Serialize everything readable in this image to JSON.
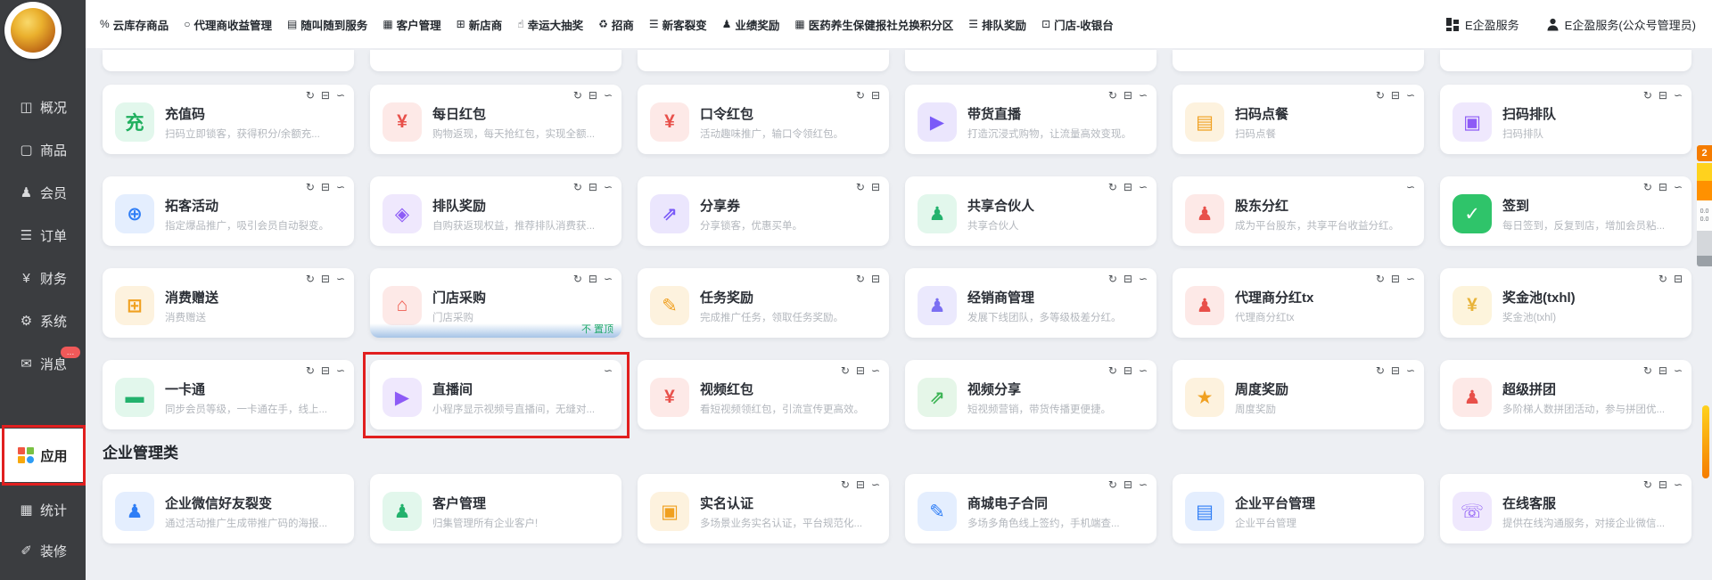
{
  "topnav": {
    "items": [
      {
        "label": "云库存商品",
        "icon": "%",
        "icon_name": "chain-link-icon"
      },
      {
        "label": "代理商收益管理",
        "icon": "○",
        "icon_name": "circle-icon"
      },
      {
        "label": "随叫随到服务",
        "icon": "▤",
        "icon_name": "service-card-icon"
      },
      {
        "label": "客户管理",
        "icon": "▦",
        "icon_name": "customer-grid-icon"
      },
      {
        "label": "新店商",
        "icon": "⊞",
        "icon_name": "new-shop-icon"
      },
      {
        "label": "幸运大抽奖",
        "icon": "☝",
        "icon_name": "lucky-draw-hand-icon"
      },
      {
        "label": "招商",
        "icon": "♻",
        "icon_name": "recycle-icon"
      },
      {
        "label": "新客裂变",
        "icon": "☰",
        "icon_name": "fission-list-icon"
      },
      {
        "label": "业绩奖励",
        "icon": "♟",
        "icon_name": "performance-award-icon"
      },
      {
        "label": "医药养生保健报社兑换积分区",
        "icon": "▦",
        "icon_name": "points-zone-icon"
      },
      {
        "label": "排队奖励",
        "icon": "☰",
        "icon_name": "queue-list-icon"
      },
      {
        "label": "门店-收银台",
        "icon": "⊡",
        "icon_name": "cashier-icon"
      }
    ],
    "service_label": "E企盈服务",
    "account_label": "E企盈服务(公众号管理员)"
  },
  "sidebar": {
    "items": [
      {
        "label": "概况",
        "icon": "◫",
        "icon_name": "overview-icon"
      },
      {
        "label": "商品",
        "icon": "▢",
        "icon_name": "goods-icon"
      },
      {
        "label": "会员",
        "icon": "♟",
        "icon_name": "members-icon"
      },
      {
        "label": "订单",
        "icon": "☰",
        "icon_name": "orders-cart-icon"
      },
      {
        "label": "财务",
        "icon": "¥",
        "icon_name": "finance-icon"
      },
      {
        "label": "系统",
        "icon": "⚙",
        "icon_name": "settings-gear-icon"
      },
      {
        "label": "消息",
        "icon": "✉",
        "icon_name": "messages-icon",
        "badge": "…"
      },
      {
        "label": "应用",
        "icon": "",
        "icon_name": "apps-icon",
        "active": true,
        "apps_icon": true,
        "red_box": true
      },
      {
        "label": "统计",
        "icon": "▦",
        "icon_name": "stats-icon"
      },
      {
        "label": "装修",
        "icon": "✐",
        "icon_name": "decorate-icon"
      }
    ]
  },
  "sections": [
    {
      "header": null,
      "rows": [
        [
          {
            "title": "充值码",
            "subtitle": "扫码立即锁客，获得积分/余额充...",
            "glyph": "充",
            "icon_name": "recharge-code-icon",
            "icon_color": "#1faf5e",
            "icon_bg": "#e2f7ec",
            "actions": [
              "sync",
              "print",
              "link"
            ]
          },
          {
            "title": "每日红包",
            "subtitle": "购物返现，每天抢红包，实现全额...",
            "glyph": "¥",
            "icon_name": "daily-redpacket-icon",
            "icon_color": "#e8504a",
            "icon_bg": "#fde9e7",
            "actions": [
              "sync",
              "print",
              "link"
            ]
          },
          {
            "title": "口令红包",
            "subtitle": "活动趣味推广，输口令领红包。",
            "glyph": "¥",
            "icon_name": "password-redpacket-icon",
            "icon_color": "#e8504a",
            "icon_bg": "#fde9e7",
            "actions": [
              "sync",
              "print"
            ]
          },
          {
            "title": "带货直播",
            "subtitle": "打造沉浸式购物，让流量高效变现。",
            "glyph": "▶",
            "icon_name": "live-commerce-icon",
            "icon_color": "#7a5af8",
            "icon_bg": "#ebe6fd",
            "actions": [
              "sync",
              "print",
              "link"
            ]
          },
          {
            "title": "扫码点餐",
            "subtitle": "扫码点餐",
            "glyph": "▤",
            "icon_name": "scan-order-icon",
            "icon_color": "#f0a020",
            "icon_bg": "#fdf2de",
            "actions": [
              "sync",
              "print",
              "link"
            ]
          },
          {
            "title": "扫码排队",
            "subtitle": "扫码排队",
            "glyph": "▣",
            "icon_name": "scan-queue-icon",
            "icon_color": "#8d5bf6",
            "icon_bg": "#efe8fd",
            "actions": [
              "sync",
              "print",
              "link"
            ]
          }
        ],
        [
          {
            "title": "拓客活动",
            "subtitle": "指定爆品推广，吸引会员自动裂变。",
            "glyph": "⊕",
            "icon_name": "customer-acquisition-icon",
            "icon_color": "#2f7ef6",
            "icon_bg": "#e4eefe",
            "actions": [
              "sync",
              "print",
              "link"
            ]
          },
          {
            "title": "排队奖励",
            "subtitle": "自购获返现权益，推荐排队消费获...",
            "glyph": "◈",
            "icon_name": "queue-reward-icon",
            "icon_color": "#8d5bf6",
            "icon_bg": "#efe8fd",
            "actions": [
              "sync",
              "print",
              "link"
            ]
          },
          {
            "title": "分享券",
            "subtitle": "分享锁客，优惠买单。",
            "glyph": "⇗",
            "icon_name": "share-coupon-icon",
            "icon_color": "#7a5af8",
            "icon_bg": "#ebe6fd",
            "actions": [
              "sync",
              "print"
            ]
          },
          {
            "title": "共享合伙人",
            "subtitle": "共享合伙人",
            "glyph": "♟",
            "icon_name": "shared-partner-icon",
            "icon_color": "#23b26d",
            "icon_bg": "#e2f7ec",
            "actions": [
              "sync",
              "print",
              "link"
            ]
          },
          {
            "title": "股东分红",
            "subtitle": "成为平台股东，共享平台收益分红。",
            "glyph": "♟",
            "icon_name": "shareholder-dividend-icon",
            "icon_color": "#e8504a",
            "icon_bg": "#fde9e7",
            "actions": [
              "link"
            ]
          },
          {
            "title": "签到",
            "subtitle": "每日签到，反复到店，增加会员粘...",
            "glyph": "✓",
            "icon_name": "checkin-calendar-icon",
            "icon_color": "#ffffff",
            "icon_bg": "#2fc46a",
            "actions": [
              "sync",
              "print",
              "link"
            ]
          }
        ],
        [
          {
            "title": "消费赠送",
            "subtitle": "消费赠送",
            "glyph": "⊞",
            "icon_name": "consume-gift-icon",
            "icon_color": "#f0a020",
            "icon_bg": "#fdf2de",
            "actions": [
              "sync",
              "print",
              "link"
            ]
          },
          {
            "title": "门店采购",
            "subtitle": "门店采购",
            "glyph": "⌂",
            "icon_name": "store-purchase-icon",
            "icon_color": "#ef5e52",
            "icon_bg": "#fde9e7",
            "actions": [
              "sync",
              "print",
              "link"
            ],
            "hl": true,
            "tag": "不 置顶"
          },
          {
            "title": "任务奖励",
            "subtitle": "完成推广任务，领取任务奖励。",
            "glyph": "✎",
            "icon_name": "task-reward-icon",
            "icon_color": "#f0a020",
            "icon_bg": "#fdf2de",
            "actions": [
              "sync",
              "print"
            ]
          },
          {
            "title": "经销商管理",
            "subtitle": "发展下线团队，多等级极差分红。",
            "glyph": "♟",
            "icon_name": "dealer-management-icon",
            "icon_color": "#7b6ff2",
            "icon_bg": "#ebe9fd",
            "actions": [
              "sync",
              "print",
              "link"
            ]
          },
          {
            "title": "代理商分红tx",
            "subtitle": "代理商分红tx",
            "glyph": "♟",
            "icon_name": "agent-dividend-icon",
            "icon_color": "#e8504a",
            "icon_bg": "#fde9e7",
            "actions": [
              "sync",
              "print",
              "link"
            ]
          },
          {
            "title": "奖金池(txhl)",
            "subtitle": "奖金池(txhl)",
            "glyph": "¥",
            "icon_name": "bonus-pool-icon",
            "icon_color": "#e8b339",
            "icon_bg": "#fdf4dc",
            "actions": [
              "sync",
              "print"
            ]
          }
        ],
        [
          {
            "title": "一卡通",
            "subtitle": "同步会员等级，一卡通在手，线上...",
            "glyph": "▬",
            "icon_name": "one-card-icon",
            "icon_color": "#23b26d",
            "icon_bg": "#e2f7ec",
            "actions": [
              "sync",
              "print",
              "link"
            ]
          },
          {
            "title": "直播间",
            "subtitle": "小程序显示视频号直播间，无缝对...",
            "glyph": "▶",
            "icon_name": "live-room-icon",
            "icon_color": "#8d5bf6",
            "icon_bg": "#efe8fd",
            "actions": [
              "link"
            ],
            "redbox": true
          },
          {
            "title": "视频红包",
            "subtitle": "看短视频领红包，引流宣传更高效。",
            "glyph": "¥",
            "icon_name": "video-redpacket-icon",
            "icon_color": "#e8504a",
            "icon_bg": "#fde9e7",
            "actions": [
              "sync",
              "print",
              "link"
            ]
          },
          {
            "title": "视频分享",
            "subtitle": "短视频营销，带货传播更便捷。",
            "glyph": "⇗",
            "icon_name": "video-share-icon",
            "icon_color": "#3cb454",
            "icon_bg": "#e5f6e8",
            "actions": [
              "sync",
              "print",
              "link"
            ]
          },
          {
            "title": "周度奖励",
            "subtitle": "周度奖励",
            "glyph": "★",
            "icon_name": "weekly-reward-icon",
            "icon_color": "#f0a020",
            "icon_bg": "#fdf2de",
            "actions": [
              "sync",
              "print",
              "link"
            ]
          },
          {
            "title": "超级拼团",
            "subtitle": "多阶梯人数拼团活动，参与拼团优...",
            "glyph": "♟",
            "icon_name": "super-groupbuy-icon",
            "icon_color": "#e8504a",
            "icon_bg": "#fde9e7",
            "actions": [
              "sync",
              "print",
              "link"
            ]
          }
        ]
      ]
    },
    {
      "header": "企业管理类",
      "rows": [
        [
          {
            "title": "企业微信好友裂变",
            "subtitle": "通过活动推广生成带推广码的海报...",
            "glyph": "♟",
            "icon_name": "wecom-fission-icon",
            "icon_color": "#2f7ef6",
            "icon_bg": "#e4eefe",
            "actions": []
          },
          {
            "title": "客户管理",
            "subtitle": "归集管理所有企业客户!",
            "glyph": "♟",
            "icon_name": "customer-management-icon",
            "icon_color": "#23b26d",
            "icon_bg": "#e2f7ec",
            "actions": []
          },
          {
            "title": "实名认证",
            "subtitle": "多场景业务实名认证，平台规范化...",
            "glyph": "▣",
            "icon_name": "realname-auth-icon",
            "icon_color": "#f0a020",
            "icon_bg": "#fdf2de",
            "actions": [
              "sync",
              "print",
              "link"
            ]
          },
          {
            "title": "商城电子合同",
            "subtitle": "多场多角色线上签约，手机端查...",
            "glyph": "✎",
            "icon_name": "e-contract-icon",
            "icon_color": "#2f7ef6",
            "icon_bg": "#e4eefe",
            "actions": [
              "sync",
              "print",
              "link"
            ]
          },
          {
            "title": "企业平台管理",
            "subtitle": "企业平台管理",
            "glyph": "▤",
            "icon_name": "enterprise-platform-icon",
            "icon_color": "#2f7ef6",
            "icon_bg": "#e4eefe",
            "actions": []
          },
          {
            "title": "在线客服",
            "subtitle": "提供在线沟通服务，对接企业微信...",
            "glyph": "☏",
            "icon_name": "online-service-icon",
            "icon_color": "#8d5bf6",
            "icon_bg": "#efe8fd",
            "actions": [
              "sync",
              "print",
              "link"
            ]
          }
        ]
      ]
    }
  ],
  "widget": {
    "badge": "2",
    "values": [
      "0.0",
      "0.0"
    ]
  },
  "annotation_color": "#e11f1f"
}
